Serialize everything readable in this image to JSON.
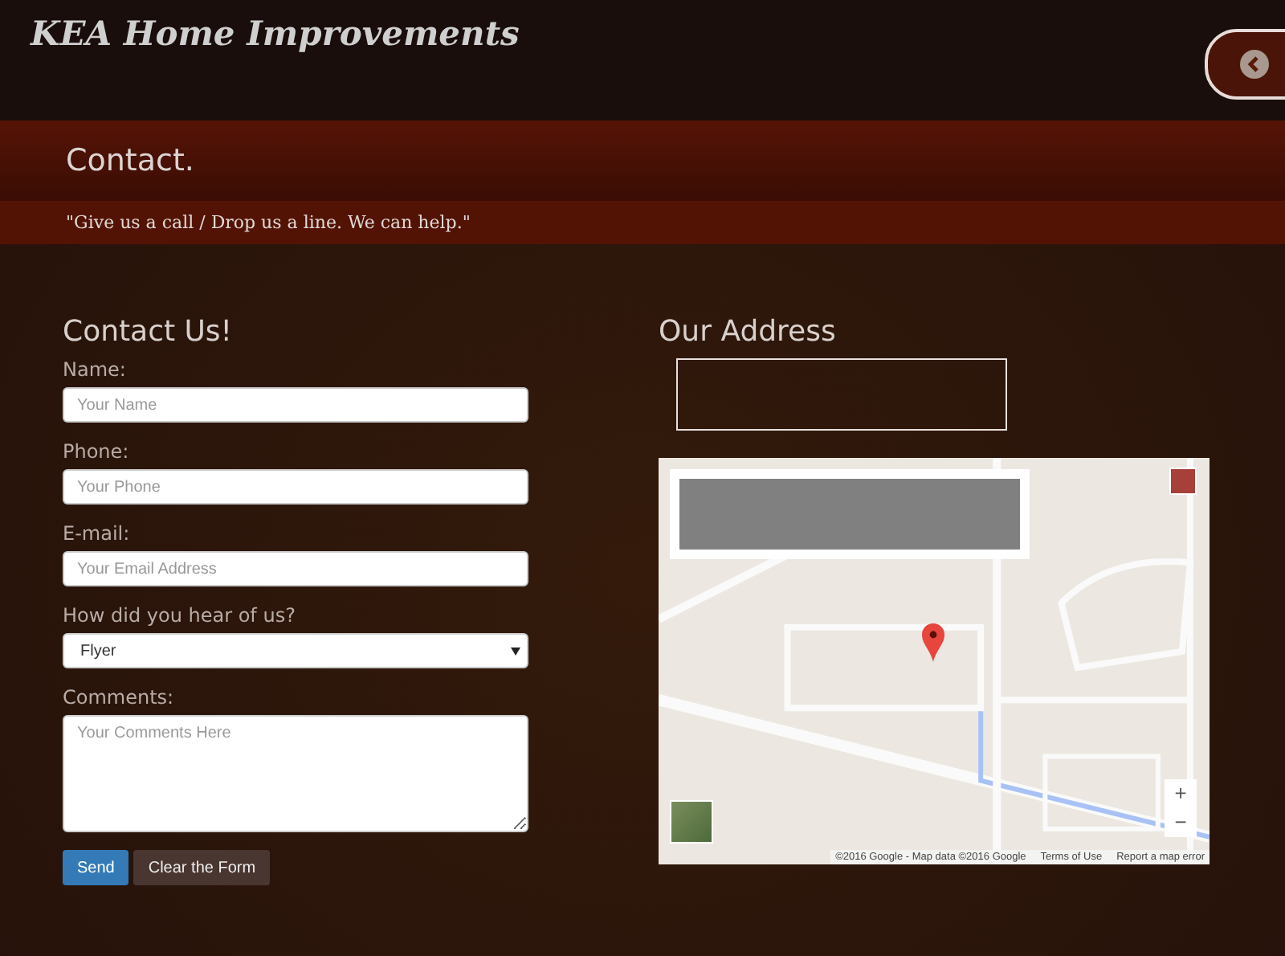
{
  "header": {
    "title": "KEA Home Improvements"
  },
  "banner": {
    "title": "Contact.",
    "tagline": "\"Give us a call / Drop us a line. We can help.\""
  },
  "contact_form": {
    "heading": "Contact Us!",
    "fields": [
      {
        "kind": "text",
        "label": "Name:",
        "placeholder": "Your Name"
      },
      {
        "kind": "text",
        "label": "Phone:",
        "placeholder": "Your Phone"
      },
      {
        "kind": "text",
        "label": "E-mail:",
        "placeholder": "Your Email Address"
      },
      {
        "kind": "select",
        "label": "How did you hear of us?",
        "value": "Flyer"
      },
      {
        "kind": "textarea",
        "label": "Comments:",
        "placeholder": "Your Comments Here"
      }
    ],
    "buttons": [
      {
        "label": "Send",
        "kind": "primary"
      },
      {
        "label": "Clear the Form",
        "kind": "secondary"
      }
    ]
  },
  "address": {
    "heading": "Our Address",
    "map": {
      "zoom_in": "+",
      "zoom_out": "−",
      "attribution": "©2016 Google - Map data ©2016 Google",
      "terms": "Terms of Use",
      "report": "Report a map error"
    }
  }
}
